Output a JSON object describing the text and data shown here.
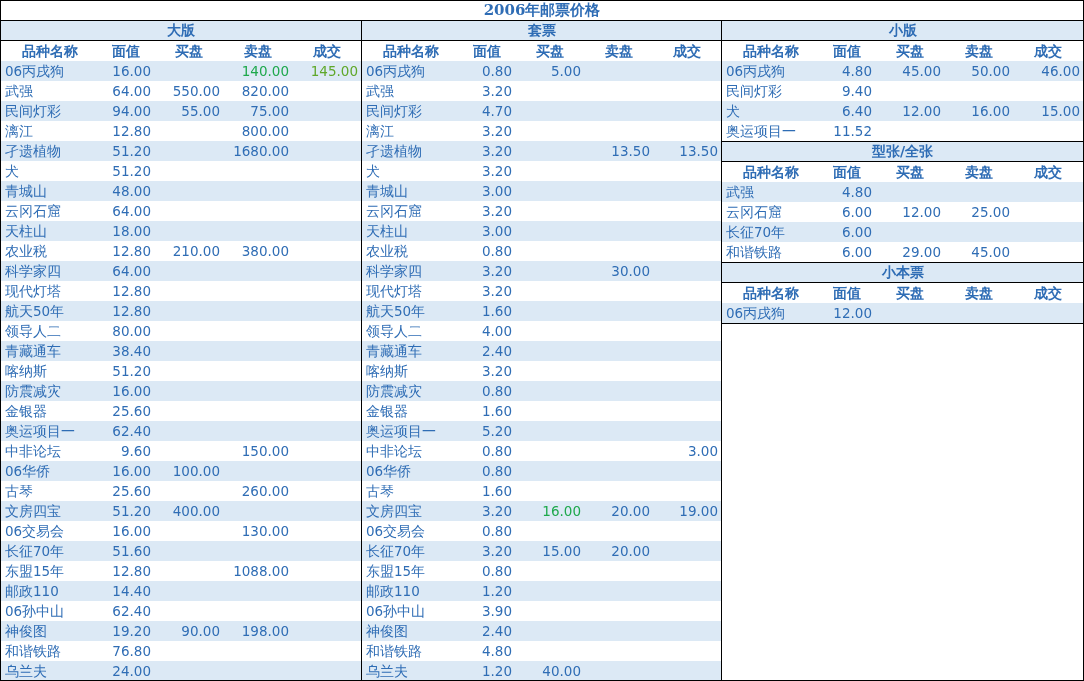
{
  "title": "2006年邮票价格",
  "panels": [
    {
      "sections": [
        {
          "title": "大版",
          "columns": [
            "品种名称",
            "面值",
            "买盘",
            "卖盘",
            "成交"
          ],
          "rows": [
            {
              "name": "06丙戌狗",
              "face": "16.00",
              "sell": {
                "text": "140.00",
                "color": "#1ea84c"
              },
              "deal": {
                "text": "145.00",
                "color": "#5fa82a"
              }
            },
            {
              "name": "武强",
              "face": "64.00",
              "buy": "550.00",
              "sell": "820.00"
            },
            {
              "name": "民间灯彩",
              "face": "94.00",
              "buy": "55.00",
              "sell": "75.00"
            },
            {
              "name": "漓江",
              "face": "12.80",
              "sell": "800.00"
            },
            {
              "name": "孑遗植物",
              "face": "51.20",
              "sell": "1680.00"
            },
            {
              "name": "犬",
              "face": "51.20"
            },
            {
              "name": "青城山",
              "face": "48.00"
            },
            {
              "name": "云冈石窟",
              "face": "64.00"
            },
            {
              "name": "天柱山",
              "face": "18.00"
            },
            {
              "name": "农业税",
              "face": "12.80",
              "buy": "210.00",
              "sell": "380.00"
            },
            {
              "name": "科学家四",
              "face": "64.00"
            },
            {
              "name": "现代灯塔",
              "face": "12.80"
            },
            {
              "name": "航天50年",
              "face": "12.80"
            },
            {
              "name": "领导人二",
              "face": "80.00"
            },
            {
              "name": "青藏通车",
              "face": "38.40"
            },
            {
              "name": "喀纳斯",
              "face": "51.20"
            },
            {
              "name": "防震减灾",
              "face": "16.00"
            },
            {
              "name": "金银器",
              "face": "25.60"
            },
            {
              "name": "奥运项目一",
              "face": "62.40"
            },
            {
              "name": "中非论坛",
              "face": "9.60",
              "sell": "150.00"
            },
            {
              "name": "06华侨",
              "face": "16.00",
              "buy": "100.00"
            },
            {
              "name": "古琴",
              "face": "25.60",
              "sell": "260.00"
            },
            {
              "name": "文房四宝",
              "face": "51.20",
              "buy": "400.00"
            },
            {
              "name": "06交易会",
              "face": "16.00",
              "sell": "130.00"
            },
            {
              "name": "长征70年",
              "face": "51.60"
            },
            {
              "name": "东盟15年",
              "face": "12.80",
              "sell": "1088.00"
            },
            {
              "name": "邮政110",
              "face": "14.40"
            },
            {
              "name": "06孙中山",
              "face": "62.40"
            },
            {
              "name": "神俊图",
              "face": "19.20",
              "buy": "90.00",
              "sell": "198.00"
            },
            {
              "name": "和谐铁路",
              "face": "76.80"
            },
            {
              "name": "乌兰夫",
              "face": "24.00"
            }
          ]
        }
      ]
    },
    {
      "sections": [
        {
          "title": "套票",
          "columns": [
            "品种名称",
            "面值",
            "买盘",
            "卖盘",
            "成交"
          ],
          "rows": [
            {
              "name": "06丙戌狗",
              "face": "0.80",
              "buy": "5.00"
            },
            {
              "name": "武强",
              "face": "3.20"
            },
            {
              "name": "民间灯彩",
              "face": "4.70"
            },
            {
              "name": "漓江",
              "face": "3.20"
            },
            {
              "name": "孑遗植物",
              "face": "3.20",
              "sell": "13.50",
              "deal": "13.50"
            },
            {
              "name": "犬",
              "face": "3.20"
            },
            {
              "name": "青城山",
              "face": "3.00"
            },
            {
              "name": "云冈石窟",
              "face": "3.20"
            },
            {
              "name": "天柱山",
              "face": "3.00"
            },
            {
              "name": "农业税",
              "face": "0.80"
            },
            {
              "name": "科学家四",
              "face": "3.20",
              "sell": "30.00"
            },
            {
              "name": "现代灯塔",
              "face": "3.20"
            },
            {
              "name": "航天50年",
              "face": "1.60"
            },
            {
              "name": "领导人二",
              "face": "4.00"
            },
            {
              "name": "青藏通车",
              "face": "2.40"
            },
            {
              "name": "喀纳斯",
              "face": "3.20"
            },
            {
              "name": "防震减灾",
              "face": "0.80"
            },
            {
              "name": "金银器",
              "face": "1.60"
            },
            {
              "name": "奥运项目一",
              "face": "5.20"
            },
            {
              "name": "中非论坛",
              "face": "0.80",
              "deal": "3.00"
            },
            {
              "name": "06华侨",
              "face": "0.80"
            },
            {
              "name": "古琴",
              "face": "1.60"
            },
            {
              "name": "文房四宝",
              "face": "3.20",
              "buy": {
                "text": "16.00",
                "color": "#1ea84c"
              },
              "sell": "20.00",
              "deal": "19.00"
            },
            {
              "name": "06交易会",
              "face": "0.80"
            },
            {
              "name": "长征70年",
              "face": "3.20",
              "buy": "15.00",
              "sell": "20.00"
            },
            {
              "name": "东盟15年",
              "face": "0.80"
            },
            {
              "name": "邮政110",
              "face": "1.20"
            },
            {
              "name": "06孙中山",
              "face": "3.90"
            },
            {
              "name": "神俊图",
              "face": "2.40"
            },
            {
              "name": "和谐铁路",
              "face": "4.80"
            },
            {
              "name": "乌兰夫",
              "face": "1.20",
              "buy": "40.00"
            }
          ]
        }
      ]
    },
    {
      "sections": [
        {
          "title": "小版",
          "columns": [
            "品种名称",
            "面值",
            "买盘",
            "卖盘",
            "成交"
          ],
          "rows": [
            {
              "name": "06丙戌狗",
              "face": "4.80",
              "buy": "45.00",
              "sell": "50.00",
              "deal": "46.00"
            },
            {
              "name": "民间灯彩",
              "face": "9.40"
            },
            {
              "name": "犬",
              "face": "6.40",
              "buy": "12.00",
              "sell": "16.00",
              "deal": "15.00"
            },
            {
              "name": "奥运项目一",
              "face": "11.52"
            }
          ]
        },
        {
          "title": "型张/全张",
          "columns": [
            "品种名称",
            "面值",
            "买盘",
            "卖盘",
            "成交"
          ],
          "rows": [
            {
              "name": "武强",
              "face": "4.80"
            },
            {
              "name": "云冈石窟",
              "face": "6.00",
              "buy": "12.00",
              "sell": "25.00"
            },
            {
              "name": "长征70年",
              "face": "6.00"
            },
            {
              "name": "和谐铁路",
              "face": "6.00",
              "buy": "29.00",
              "sell": "45.00"
            }
          ]
        },
        {
          "title": "小本票",
          "columns": [
            "品种名称",
            "面值",
            "买盘",
            "卖盘",
            "成交"
          ],
          "rows": [
            {
              "name": "06丙戌狗",
              "face": "12.00"
            }
          ]
        }
      ]
    }
  ]
}
